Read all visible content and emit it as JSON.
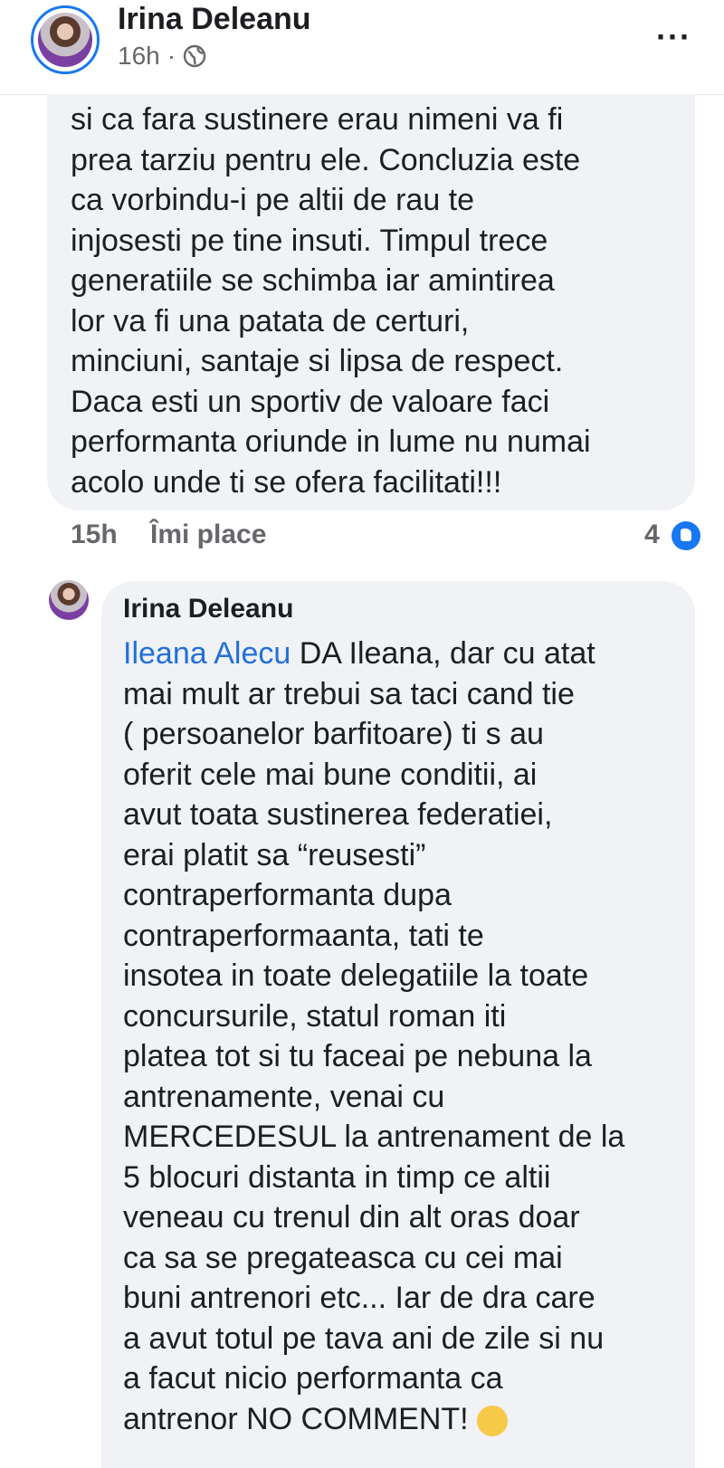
{
  "header": {
    "author_name": "Irina Deleanu",
    "time": "16h",
    "separator": "·",
    "more_label": "···"
  },
  "comment": {
    "text": "si ca fara sustinere erau nimeni va fi\nprea tarziu pentru ele. Concluzia este\nca vorbindu-i pe altii de rau te\ninjosesti pe tine insuti. Timpul trece\ngeneratiile se schimba iar amintirea\nlor va fi una patata de certuri,\nminciuni, santaje si lipsa de respect.\nDaca esti un sportiv de valoare faci\nperformanta oriunde in lume nu numai\nacolo unde ti se ofera facilitati!!!",
    "time": "15h",
    "like_label": "Îmi place",
    "reaction_count": "4"
  },
  "reply": {
    "author_name": "Irina Deleanu",
    "mention": "Ileana Alecu",
    "text": " DA Ileana, dar cu atat\nmai mult ar trebui sa taci cand tie\n( persoanelor barfitoare) ti s au\noferit cele mai bune conditii, ai\navut toata sustinerea federatiei,\nerai platit sa “reusesti”\ncontraperformanta dupa\ncontraperformaanta, tati te\ninsotea in toate delegatiile la toate\nconcursurile, statul roman iti\nplatea tot si tu faceai pe nebuna la\nantrenamente, venai cu\nMERCEDESUL la antrenament de la\n5 blocuri distanta in timp ce altii\nveneau cu trenul din alt oras doar\nca sa se pregateasca cu cei mai\nbuni antrenori etc... Iar de dra care\na avut totul pe tava ani de zile si nu\na facut nicio performanta ca\nantrenor NO COMMENT!"
  },
  "colors": {
    "bubble_bg": "#f0f2f5",
    "mention": "#216fdb",
    "avatar_ring": "#1877f2",
    "meta_text": "#65676b"
  },
  "icons": {
    "globe": "globe-icon",
    "more": "more-options-icon",
    "reaction": "like-reaction-icon",
    "emoji": "neutral-face-emoji-icon"
  }
}
